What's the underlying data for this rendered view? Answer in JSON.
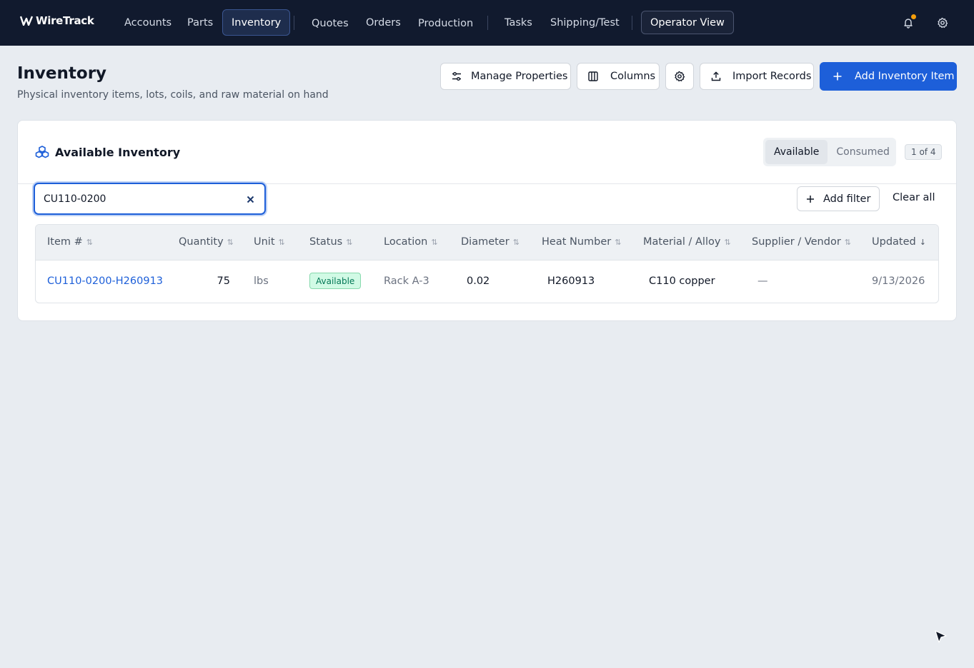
{
  "brand": {
    "name": "WireTrack"
  },
  "nav": {
    "items": [
      {
        "label": "Accounts"
      },
      {
        "label": "Parts"
      },
      {
        "label": "Inventory"
      },
      {
        "label": "Quotes"
      },
      {
        "label": "Orders"
      },
      {
        "label": "Production"
      },
      {
        "label": "Tasks"
      },
      {
        "label": "Shipping/Test"
      }
    ],
    "operator_view": "Operator View"
  },
  "header": {
    "title": "Inventory",
    "subtitle": "Physical inventory items, lots, coils, and raw material on hand",
    "buttons": {
      "manage_properties": "Manage Properties",
      "columns": "Columns",
      "import_records": "Import Records",
      "add_item": "Add Inventory Item"
    }
  },
  "card": {
    "title": "Available Inventory",
    "segments": {
      "available": "Available",
      "consumed": "Consumed"
    },
    "count": "1 of 4",
    "search": {
      "value": "CU110-0200",
      "placeholder": ""
    },
    "add_filter": "Add filter",
    "clear_all": "Clear all"
  },
  "table": {
    "columns": [
      "Item #",
      "Quantity",
      "Unit",
      "Status",
      "Location",
      "Diameter",
      "Heat Number",
      "Material / Alloy",
      "Supplier / Vendor",
      "Updated"
    ],
    "rows": [
      {
        "item": "CU110-0200-H260913",
        "quantity": "75",
        "unit": "lbs",
        "status": "Available",
        "location": "Rack A-3",
        "diameter": "0.02",
        "heat_number": "H260913",
        "material": "C110 copper",
        "supplier": "—",
        "updated": "9/13/2026"
      }
    ]
  },
  "colors": {
    "nav_bg": "#111a2e",
    "primary": "#1d5fd9",
    "status_available": "#047857"
  }
}
